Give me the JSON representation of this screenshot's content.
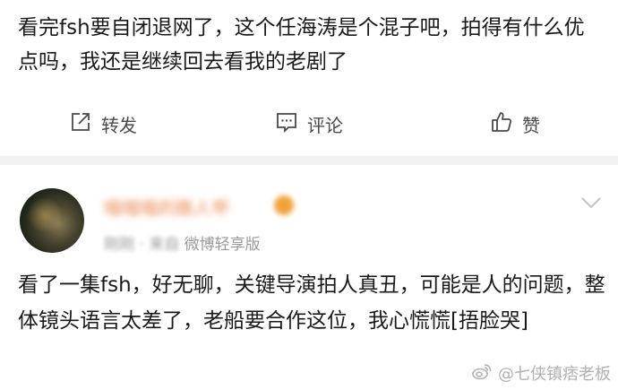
{
  "post": {
    "text": "看完fsh要自闭退网了，这个任海涛是个混子吧，拍得有什么优点吗，我还是继续回去看我的老剧了"
  },
  "actions": {
    "repost_label": "转发",
    "comment_label": "评论",
    "like_label": "赞"
  },
  "comment": {
    "username": "喵喵喵的路人甲",
    "meta_blurred": "刚刚 · 来自",
    "meta_source": "微博轻享版",
    "text": "看了一集fsh，好无聊，关键导演拍人真丑，可能是人的问题，整体镜头语言太差了，老船要合作这位，我心慌慌[捂脸哭]"
  },
  "watermark": {
    "text": "@七侠镇痞老板"
  },
  "colors": {
    "username": "#e8864a",
    "icon": "#4a4a4a",
    "meta": "#9a9a9a",
    "separator": "#f2f2f2"
  },
  "icons": [
    "repost-icon",
    "comment-icon",
    "like-icon",
    "chevron-down-icon",
    "weibo-icon"
  ]
}
